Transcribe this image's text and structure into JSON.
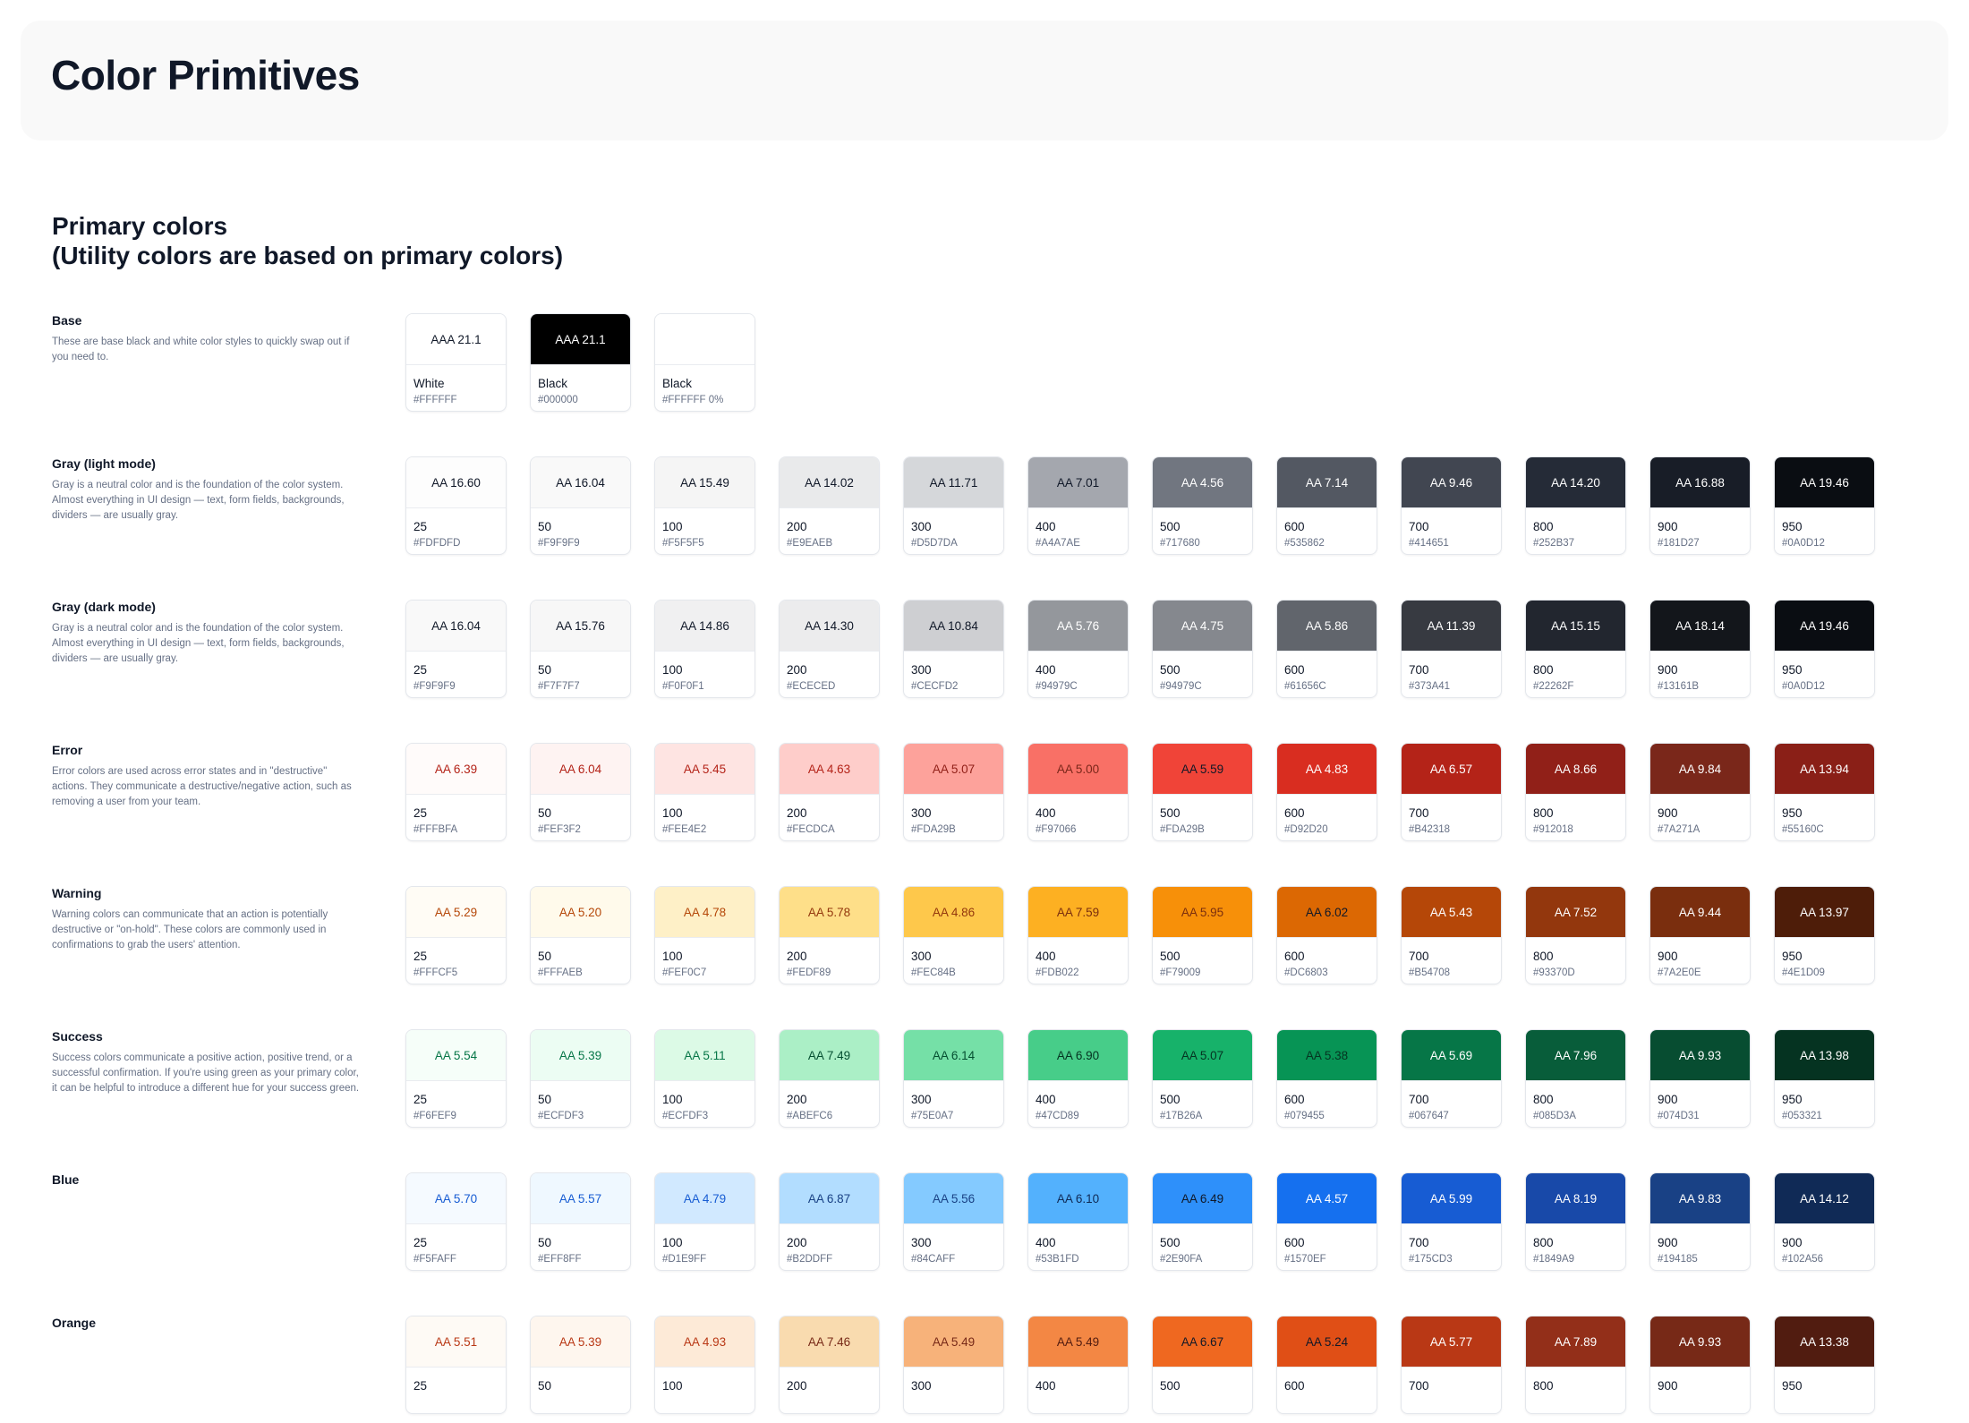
{
  "page": {
    "title": "Color Primitives"
  },
  "section": {
    "title_line1": "Primary colors",
    "title_line2": "(Utility colors are based on primary colors)"
  },
  "rows": [
    {
      "name": "Base",
      "description": "These are base black and white color styles to quickly swap out if you need to.",
      "swatches": [
        {
          "label": "AAA 21.1",
          "name": "White",
          "hex": "#FFFFFF",
          "bg": "#FFFFFF",
          "fg": "#101828"
        },
        {
          "label": "AAA 21.1",
          "name": "Black",
          "hex": "#000000",
          "bg": "#000000",
          "fg": "#FFFFFF"
        },
        {
          "label": "",
          "name": "Black",
          "hex": "#FFFFFF 0%",
          "bg": "#FFFFFF",
          "fg": "#101828"
        }
      ]
    },
    {
      "name": "Gray (light mode)",
      "description": "Gray is a neutral color and is the foundation of the color system. Almost everything in UI design — text, form fields, backgrounds, dividers — are usually gray.",
      "swatches": [
        {
          "label": "AA 16.60",
          "name": "25",
          "hex": "#FDFDFD",
          "bg": "#FDFDFD",
          "fg": "#101828"
        },
        {
          "label": "AA 16.04",
          "name": "50",
          "hex": "#F9F9F9",
          "bg": "#F9F9F9",
          "fg": "#101828"
        },
        {
          "label": "AA 15.49",
          "name": "100",
          "hex": "#F5F5F5",
          "bg": "#F5F5F5",
          "fg": "#101828"
        },
        {
          "label": "AA 14.02",
          "name": "200",
          "hex": "#E9EAEB",
          "bg": "#E9EAEB",
          "fg": "#101828"
        },
        {
          "label": "AA 11.71",
          "name": "300",
          "hex": "#D5D7DA",
          "bg": "#D5D7DA",
          "fg": "#101828"
        },
        {
          "label": "AA 7.01",
          "name": "400",
          "hex": "#A4A7AE",
          "bg": "#A4A7AE",
          "fg": "#101828"
        },
        {
          "label": "AA 4.56",
          "name": "500",
          "hex": "#717680",
          "bg": "#717680",
          "fg": "#FFFFFF"
        },
        {
          "label": "AA 7.14",
          "name": "600",
          "hex": "#535862",
          "bg": "#535862",
          "fg": "#FFFFFF"
        },
        {
          "label": "AA 9.46",
          "name": "700",
          "hex": "#414651",
          "bg": "#414651",
          "fg": "#FFFFFF"
        },
        {
          "label": "AA 14.20",
          "name": "800",
          "hex": "#252B37",
          "bg": "#252B37",
          "fg": "#FFFFFF"
        },
        {
          "label": "AA 16.88",
          "name": "900",
          "hex": "#181D27",
          "bg": "#181D27",
          "fg": "#FFFFFF"
        },
        {
          "label": "AA 19.46",
          "name": "950",
          "hex": "#0A0D12",
          "bg": "#0A0D12",
          "fg": "#FFFFFF"
        }
      ]
    },
    {
      "name": "Gray (dark mode)",
      "description": "Gray is a neutral color and is the foundation of the color system. Almost everything in UI design — text, form fields, backgrounds, dividers — are usually gray.",
      "swatches": [
        {
          "label": "AA 16.04",
          "name": "25",
          "hex": "#F9F9F9",
          "bg": "#F9F9F9",
          "fg": "#101828"
        },
        {
          "label": "AA 15.76",
          "name": "50",
          "hex": "#F7F7F7",
          "bg": "#F7F7F7",
          "fg": "#101828"
        },
        {
          "label": "AA 14.86",
          "name": "100",
          "hex": "#F0F0F1",
          "bg": "#F0F0F1",
          "fg": "#101828"
        },
        {
          "label": "AA 14.30",
          "name": "200",
          "hex": "#ECECED",
          "bg": "#ECECED",
          "fg": "#101828"
        },
        {
          "label": "AA 10.84",
          "name": "300",
          "hex": "#CECFD2",
          "bg": "#CECFD2",
          "fg": "#101828"
        },
        {
          "label": "AA 5.76",
          "name": "400",
          "hex": "#94979C",
          "bg": "#94979C",
          "fg": "#FFFFFF"
        },
        {
          "label": "AA 4.75",
          "name": "500",
          "hex": "#94979C",
          "bg": "#85888E",
          "fg": "#FFFFFF"
        },
        {
          "label": "AA 5.86",
          "name": "600",
          "hex": "#61656C",
          "bg": "#61656C",
          "fg": "#FFFFFF"
        },
        {
          "label": "AA 11.39",
          "name": "700",
          "hex": "#373A41",
          "bg": "#373A41",
          "fg": "#FFFFFF"
        },
        {
          "label": "AA 15.15",
          "name": "800",
          "hex": "#22262F",
          "bg": "#22262F",
          "fg": "#FFFFFF"
        },
        {
          "label": "AA 18.14",
          "name": "900",
          "hex": "#13161B",
          "bg": "#13161B",
          "fg": "#FFFFFF"
        },
        {
          "label": "AA 19.46",
          "name": "950",
          "hex": "#0A0D12",
          "bg": "#0A0D12",
          "fg": "#FFFFFF"
        }
      ]
    },
    {
      "name": "Error",
      "description": "Error colors are used across error states and in \"destructive\" actions. They communicate a destructive/negative action, such as removing a user from your team.",
      "swatches": [
        {
          "label": "AA 6.39",
          "name": "25",
          "hex": "#FFFBFA",
          "bg": "#FFFBFA",
          "fg": "#B42318"
        },
        {
          "label": "AA 6.04",
          "name": "50",
          "hex": "#FEF3F2",
          "bg": "#FEF3F2",
          "fg": "#B42318"
        },
        {
          "label": "AA 5.45",
          "name": "100",
          "hex": "#FEE4E2",
          "bg": "#FEE4E2",
          "fg": "#B42318"
        },
        {
          "label": "AA 4.63",
          "name": "200",
          "hex": "#FECDCA",
          "bg": "#FECDCA",
          "fg": "#B42318"
        },
        {
          "label": "AA 5.07",
          "name": "300",
          "hex": "#FDA29B",
          "bg": "#FDA29B",
          "fg": "#912018"
        },
        {
          "label": "AA 5.00",
          "name": "400",
          "hex": "#F97066",
          "bg": "#F97066",
          "fg": "#7A271A"
        },
        {
          "label": "AA 5.59",
          "name": "500",
          "hex": "#FDA29B",
          "bg": "#F04438",
          "fg": "#101828"
        },
        {
          "label": "AA 4.83",
          "name": "600",
          "hex": "#D92D20",
          "bg": "#D92D20",
          "fg": "#FFFFFF"
        },
        {
          "label": "AA 6.57",
          "name": "700",
          "hex": "#B42318",
          "bg": "#B42318",
          "fg": "#FFFFFF"
        },
        {
          "label": "AA 8.66",
          "name": "800",
          "hex": "#912018",
          "bg": "#912018",
          "fg": "#FFFFFF"
        },
        {
          "label": "AA 9.84",
          "name": "900",
          "hex": "#7A271A",
          "bg": "#7A271A",
          "fg": "#FFFFFF"
        },
        {
          "label": "AA 13.94",
          "name": "950",
          "hex": "#55160C",
          "bg": "#8A1F17",
          "fg": "#FFFFFF"
        }
      ]
    },
    {
      "name": "Warning",
      "description": "Warning colors can communicate that an action is potentially destructive or \"on-hold\". These colors are commonly used in confirmations to grab the users' attention.",
      "swatches": [
        {
          "label": "AA 5.29",
          "name": "25",
          "hex": "#FFFCF5",
          "bg": "#FFFCF5",
          "fg": "#B54708"
        },
        {
          "label": "AA 5.20",
          "name": "50",
          "hex": "#FFFAEB",
          "bg": "#FFFAEB",
          "fg": "#B54708"
        },
        {
          "label": "AA 4.78",
          "name": "100",
          "hex": "#FEF0C7",
          "bg": "#FEF0C7",
          "fg": "#B54708"
        },
        {
          "label": "AA 5.78",
          "name": "200",
          "hex": "#FEDF89",
          "bg": "#FEDF89",
          "fg": "#93370D"
        },
        {
          "label": "AA 4.86",
          "name": "300",
          "hex": "#FEC84B",
          "bg": "#FEC84B",
          "fg": "#93370D"
        },
        {
          "label": "AA 7.59",
          "name": "400",
          "hex": "#FDB022",
          "bg": "#FDB022",
          "fg": "#7A2E0E"
        },
        {
          "label": "AA 5.95",
          "name": "500",
          "hex": "#F79009",
          "bg": "#F79009",
          "fg": "#7A2E0E"
        },
        {
          "label": "AA 6.02",
          "name": "600",
          "hex": "#DC6803",
          "bg": "#DC6803",
          "fg": "#101828"
        },
        {
          "label": "AA 5.43",
          "name": "700",
          "hex": "#B54708",
          "bg": "#B54708",
          "fg": "#FFFFFF"
        },
        {
          "label": "AA 7.52",
          "name": "800",
          "hex": "#93370D",
          "bg": "#93370D",
          "fg": "#FFFFFF"
        },
        {
          "label": "AA 9.44",
          "name": "900",
          "hex": "#7A2E0E",
          "bg": "#7A2E0E",
          "fg": "#FFFFFF"
        },
        {
          "label": "AA 13.97",
          "name": "950",
          "hex": "#4E1D09",
          "bg": "#4E1D09",
          "fg": "#FFFFFF"
        }
      ]
    },
    {
      "name": "Success",
      "description": "Success colors communicate a positive action, positive trend, or a successful confirmation. If you're using green as your primary color, it can be helpful to introduce a different hue for your success green.",
      "swatches": [
        {
          "label": "AA 5.54",
          "name": "25",
          "hex": "#F6FEF9",
          "bg": "#F6FEF9",
          "fg": "#067647"
        },
        {
          "label": "AA 5.39",
          "name": "50",
          "hex": "#ECFDF3",
          "bg": "#ECFDF3",
          "fg": "#067647"
        },
        {
          "label": "AA 5.11",
          "name": "100",
          "hex": "#ECFDF3",
          "bg": "#DCFAE6",
          "fg": "#067647"
        },
        {
          "label": "AA 7.49",
          "name": "200",
          "hex": "#ABEFC6",
          "bg": "#ABEFC6",
          "fg": "#054F31"
        },
        {
          "label": "AA 6.14",
          "name": "300",
          "hex": "#75E0A7",
          "bg": "#75E0A7",
          "fg": "#054F31"
        },
        {
          "label": "AA 6.90",
          "name": "400",
          "hex": "#47CD89",
          "bg": "#47CD89",
          "fg": "#053321"
        },
        {
          "label": "AA 5.07",
          "name": "500",
          "hex": "#17B26A",
          "bg": "#17B26A",
          "fg": "#053321"
        },
        {
          "label": "AA 5.38",
          "name": "600",
          "hex": "#079455",
          "bg": "#079455",
          "fg": "#053321"
        },
        {
          "label": "AA 5.69",
          "name": "700",
          "hex": "#067647",
          "bg": "#067647",
          "fg": "#FFFFFF"
        },
        {
          "label": "AA 7.96",
          "name": "800",
          "hex": "#085D3A",
          "bg": "#085D3A",
          "fg": "#FFFFFF"
        },
        {
          "label": "AA 9.93",
          "name": "900",
          "hex": "#074D31",
          "bg": "#074D31",
          "fg": "#FFFFFF"
        },
        {
          "label": "AA 13.98",
          "name": "950",
          "hex": "#053321",
          "bg": "#053321",
          "fg": "#FFFFFF"
        }
      ]
    },
    {
      "name": "Blue",
      "description": "",
      "swatches": [
        {
          "label": "AA 5.70",
          "name": "25",
          "hex": "#F5FAFF",
          "bg": "#F5FAFF",
          "fg": "#175CD3"
        },
        {
          "label": "AA 5.57",
          "name": "50",
          "hex": "#EFF8FF",
          "bg": "#EFF8FF",
          "fg": "#175CD3"
        },
        {
          "label": "AA 4.79",
          "name": "100",
          "hex": "#D1E9FF",
          "bg": "#D1E9FF",
          "fg": "#175CD3"
        },
        {
          "label": "AA 6.87",
          "name": "200",
          "hex": "#B2DDFF",
          "bg": "#B2DDFF",
          "fg": "#194185"
        },
        {
          "label": "AA 5.56",
          "name": "300",
          "hex": "#84CAFF",
          "bg": "#84CAFF",
          "fg": "#194185"
        },
        {
          "label": "AA 6.10",
          "name": "400",
          "hex": "#53B1FD",
          "bg": "#53B1FD",
          "fg": "#102A56"
        },
        {
          "label": "AA 6.49",
          "name": "500",
          "hex": "#2E90FA",
          "bg": "#2E90FA",
          "fg": "#101828"
        },
        {
          "label": "AA 4.57",
          "name": "600",
          "hex": "#1570EF",
          "bg": "#1570EF",
          "fg": "#FFFFFF"
        },
        {
          "label": "AA 5.99",
          "name": "700",
          "hex": "#175CD3",
          "bg": "#175CD3",
          "fg": "#FFFFFF"
        },
        {
          "label": "AA 8.19",
          "name": "800",
          "hex": "#1849A9",
          "bg": "#1849A9",
          "fg": "#FFFFFF"
        },
        {
          "label": "AA 9.83",
          "name": "900",
          "hex": "#194185",
          "bg": "#194185",
          "fg": "#FFFFFF"
        },
        {
          "label": "AA 14.12",
          "name": "900",
          "hex": "#102A56",
          "bg": "#102A56",
          "fg": "#FFFFFF"
        }
      ]
    },
    {
      "name": "Orange",
      "description": "",
      "swatches": [
        {
          "label": "AA 5.51",
          "name": "25",
          "hex": "",
          "bg": "#FEFAF5",
          "fg": "#B93815"
        },
        {
          "label": "AA 5.39",
          "name": "50",
          "hex": "",
          "bg": "#FEF6EE",
          "fg": "#B93815"
        },
        {
          "label": "AA 4.93",
          "name": "100",
          "hex": "",
          "bg": "#FDEAD7",
          "fg": "#B93815"
        },
        {
          "label": "AA 7.46",
          "name": "200",
          "hex": "",
          "bg": "#F9DBAF",
          "fg": "#772917"
        },
        {
          "label": "AA 5.49",
          "name": "300",
          "hex": "",
          "bg": "#F7B27A",
          "fg": "#772917"
        },
        {
          "label": "AA 5.49",
          "name": "400",
          "hex": "",
          "bg": "#F38744",
          "fg": "#511C10"
        },
        {
          "label": "AA 6.67",
          "name": "500",
          "hex": "",
          "bg": "#EF6820",
          "fg": "#101828"
        },
        {
          "label": "AA 5.24",
          "name": "600",
          "hex": "",
          "bg": "#E04F16",
          "fg": "#101828"
        },
        {
          "label": "AA 5.77",
          "name": "700",
          "hex": "",
          "bg": "#B93815",
          "fg": "#FFFFFF"
        },
        {
          "label": "AA 7.89",
          "name": "800",
          "hex": "",
          "bg": "#932F19",
          "fg": "#FFFFFF"
        },
        {
          "label": "AA 9.93",
          "name": "900",
          "hex": "",
          "bg": "#772917",
          "fg": "#FFFFFF"
        },
        {
          "label": "AA 13.38",
          "name": "950",
          "hex": "",
          "bg": "#511C10",
          "fg": "#FFFFFF"
        }
      ]
    }
  ]
}
